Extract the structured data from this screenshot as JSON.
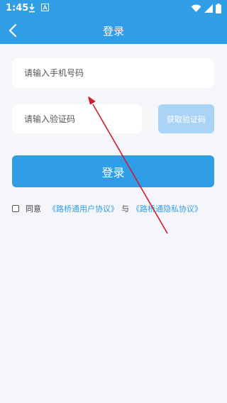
{
  "status_bar": {
    "time": "1:45",
    "icons": [
      "download-icon",
      "a-icon",
      "wifi-icon",
      "signal-icon",
      "battery-icon"
    ]
  },
  "header": {
    "title": "登录",
    "back_icon": "chevron-left-icon"
  },
  "form": {
    "phone_placeholder": "请输入手机号码",
    "code_placeholder": "请输入验证码",
    "get_code_label": "获取验证码",
    "login_label": "登录"
  },
  "agreement": {
    "prefix": "同意",
    "user_agreement": "《路桥通用户协议》",
    "and": "与",
    "privacy_agreement": "《路桥通隐私协议》",
    "checked": false
  },
  "colors": {
    "brand": "#2f9ee6",
    "button_disabled": "#a9d4f6",
    "background": "#f5f6fa",
    "annotation_arrow": "#d11a2a"
  }
}
